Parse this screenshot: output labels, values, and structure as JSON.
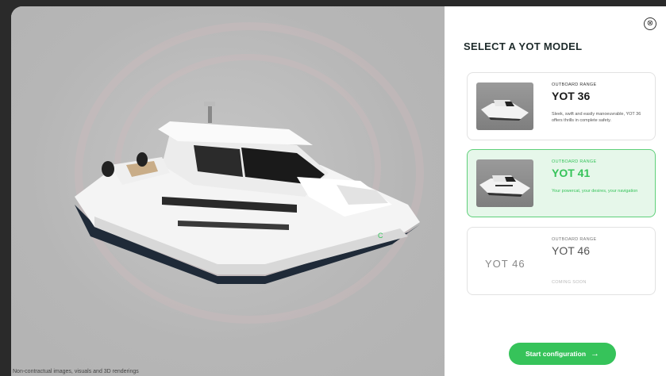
{
  "viewer": {
    "disclaimer": "Non-contractual images, visuals and 3D renderings"
  },
  "panel": {
    "close_icon": "⊗",
    "title": "SELECT A YOT MODEL",
    "models": [
      {
        "range": "OUTBOARD RANGE",
        "name": "YOT 36",
        "description": "Sleek, swift and easily manoeuvrable, YOT 36 offers thrills in complete safety.",
        "selected": false
      },
      {
        "range": "OUTBOARD RANGE",
        "name": "YOT 41",
        "description": "Your powercat, your desires, your navigation",
        "selected": true
      },
      {
        "range": "OUTBOARD RANGE",
        "name": "YOT 46",
        "logo_text": "YOT 46",
        "status": "COMING SOON",
        "selected": false
      }
    ],
    "start_button": {
      "label": "Start configuration",
      "arrow": "→"
    }
  },
  "colors": {
    "accent": "#36c35a",
    "selected_bg": "#e6f7ea",
    "viewer_bg": "#b8b8b8"
  }
}
